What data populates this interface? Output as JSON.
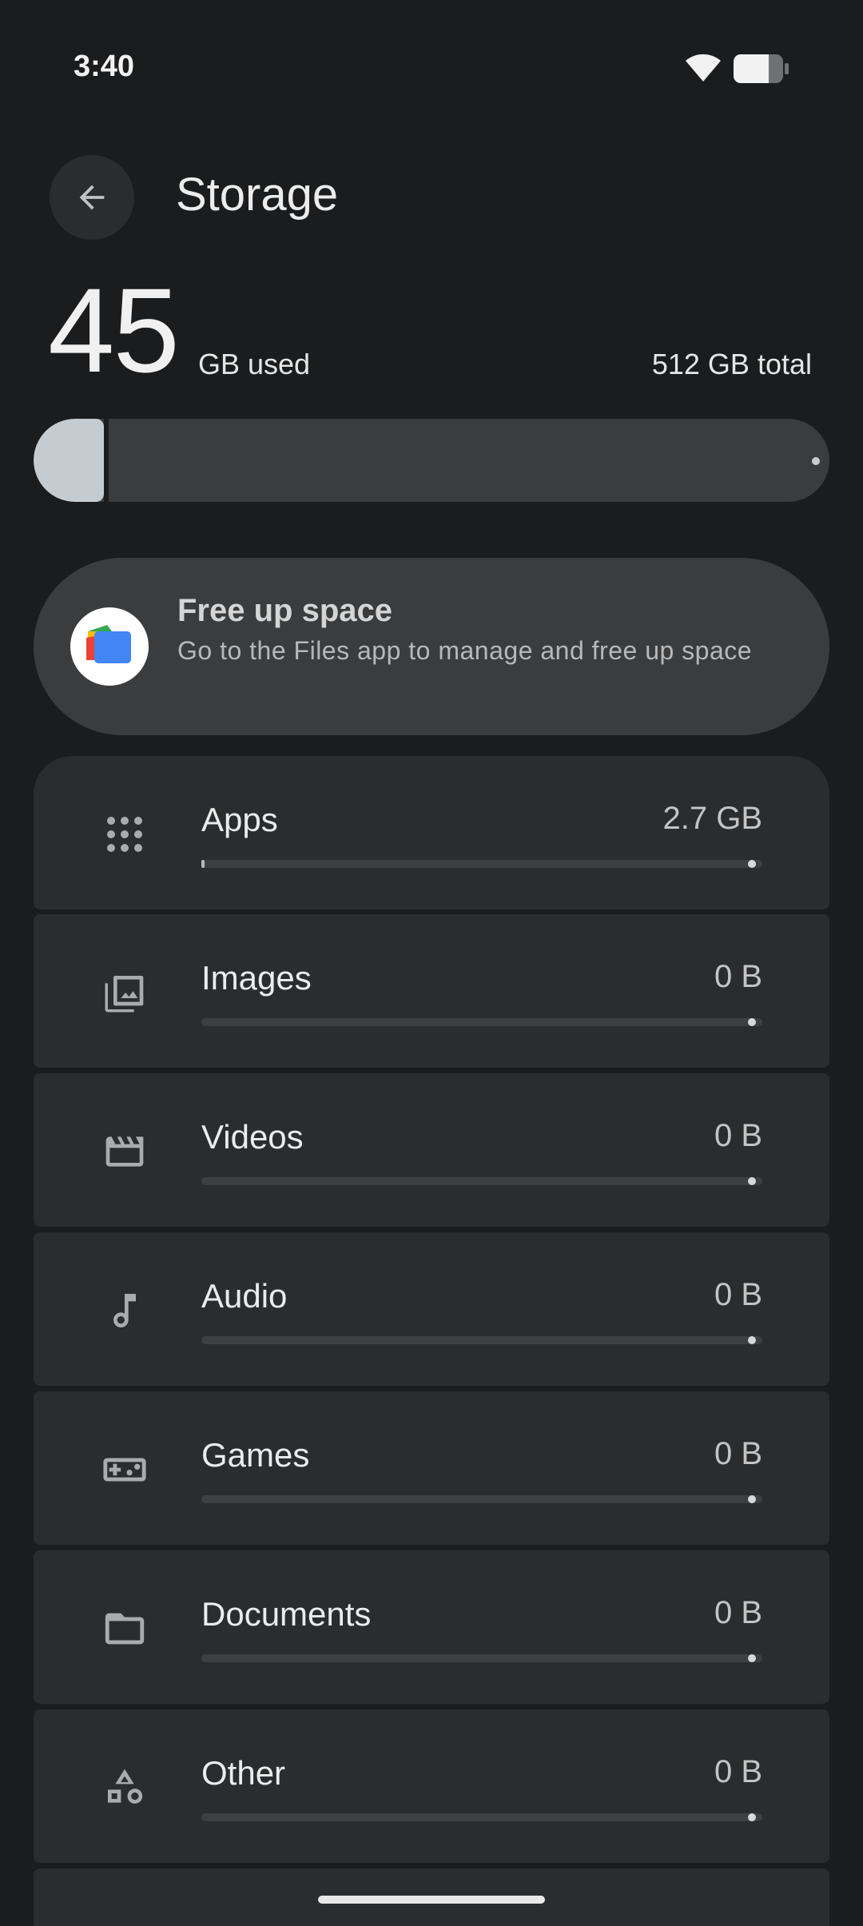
{
  "status_bar": {
    "time": "3:40",
    "wifi_icon": "wifi-icon",
    "battery_icon": "battery-icon"
  },
  "header": {
    "title": "Storage",
    "back_icon": "arrow-back-icon"
  },
  "usage": {
    "used_value": "45",
    "used_label": "GB used",
    "total_label": "512 GB total",
    "used_fraction": 0.088,
    "fill_color": "#c4ccd1"
  },
  "free_up": {
    "title": "Free up space",
    "description": "Go to the Files app to manage and free up space",
    "icon": "files-app-icon"
  },
  "categories": [
    {
      "label": "Apps",
      "size": "2.7 GB",
      "icon": "apps-grid-icon",
      "fraction": 0.005
    },
    {
      "label": "Images",
      "size": "0 B",
      "icon": "images-icon",
      "fraction": 0
    },
    {
      "label": "Videos",
      "size": "0 B",
      "icon": "videos-icon",
      "fraction": 0
    },
    {
      "label": "Audio",
      "size": "0 B",
      "icon": "audio-icon",
      "fraction": 0
    },
    {
      "label": "Games",
      "size": "0 B",
      "icon": "games-icon",
      "fraction": 0
    },
    {
      "label": "Documents",
      "size": "0 B",
      "icon": "documents-icon",
      "fraction": 0
    },
    {
      "label": "Other",
      "size": "0 B",
      "icon": "other-icon",
      "fraction": 0
    }
  ]
}
